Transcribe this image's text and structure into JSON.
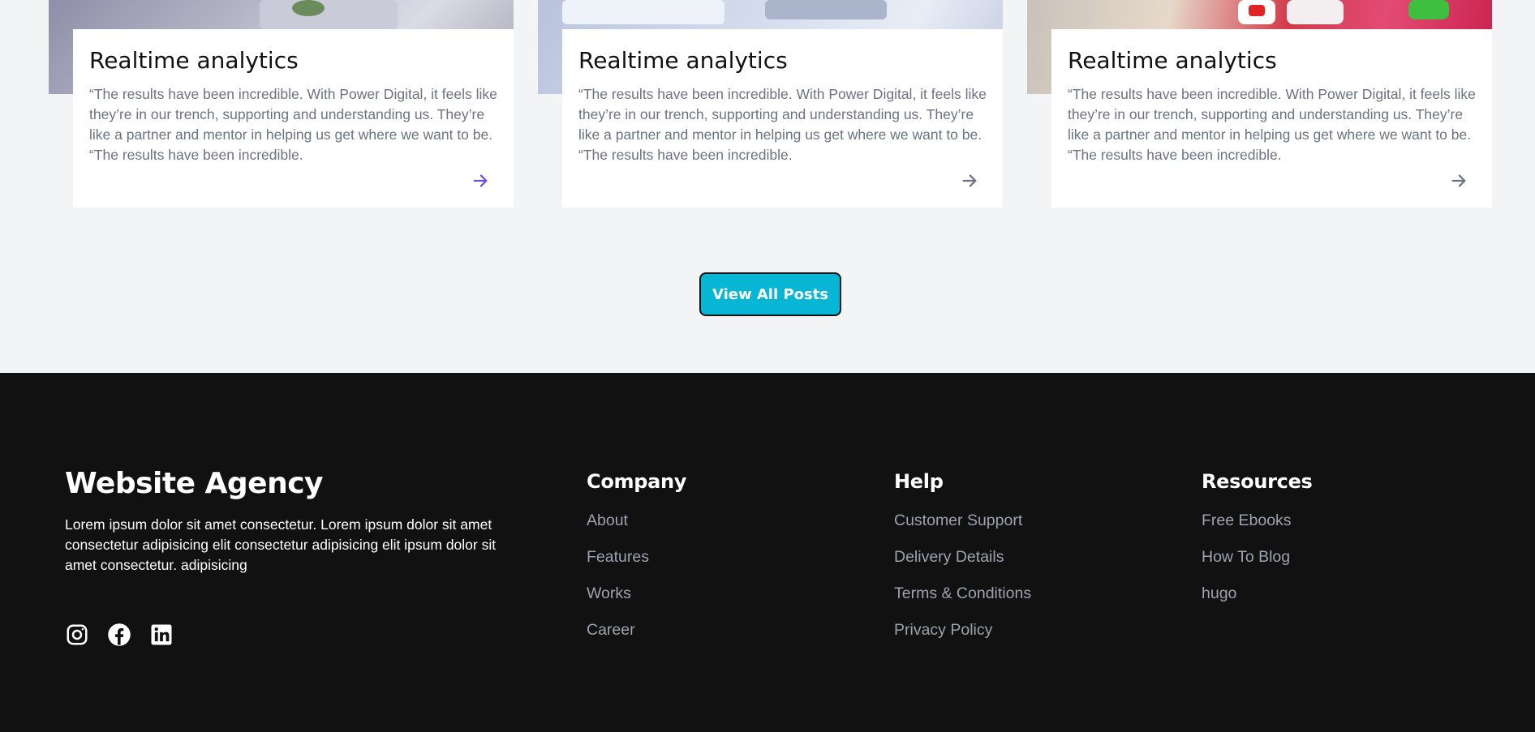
{
  "posts": [
    {
      "title": "Realtime analytics",
      "excerpt": "“The results have been incredible. With Power Digital, it feels like they’re in our trench, supporting and understanding us. They’re like a partner and mentor in helping us get where we want to be. “The results have been incredible.",
      "arrow_icon": "arrow-right-icon",
      "arrow_color": "#6d4fe0"
    },
    {
      "title": "Realtime analytics",
      "excerpt": "“The results have been incredible. With Power Digital, it feels like they’re in our trench, supporting and understanding us. They’re like a partner and mentor in helping us get where we want to be. “The results have been incredible.",
      "arrow_icon": "arrow-right-icon",
      "arrow_color": "#6b7280"
    },
    {
      "title": "Realtime analytics",
      "excerpt": "“The results have been incredible. With Power Digital, it feels like they’re in our trench, supporting and understanding us. They’re like a partner and mentor in helping us get where we want to be. “The results have been incredible.",
      "arrow_icon": "arrow-right-icon",
      "arrow_color": "#6b7280"
    }
  ],
  "view_all": {
    "label": "View All Posts",
    "bg_color": "#06b6d4"
  },
  "footer": {
    "bg_color": "#111111",
    "brand": {
      "title": "Website Agency",
      "description": "Lorem ipsum dolor sit amet consectetur. Lorem ipsum dolor sit amet consectetur adipisicing elit consectetur adipisicing elit ipsum dolor sit amet consectetur. adipisicing"
    },
    "social": [
      "instagram-icon",
      "facebook-icon",
      "linkedin-icon"
    ],
    "columns": [
      {
        "heading": "Company",
        "links": [
          "About",
          "Features",
          "Works",
          "Career"
        ]
      },
      {
        "heading": "Help",
        "links": [
          "Customer Support",
          "Delivery Details",
          "Terms & Conditions",
          "Privacy Policy"
        ]
      },
      {
        "heading": "Resources",
        "links": [
          "Free Ebooks",
          "How To Blog",
          "hugo"
        ]
      }
    ]
  }
}
